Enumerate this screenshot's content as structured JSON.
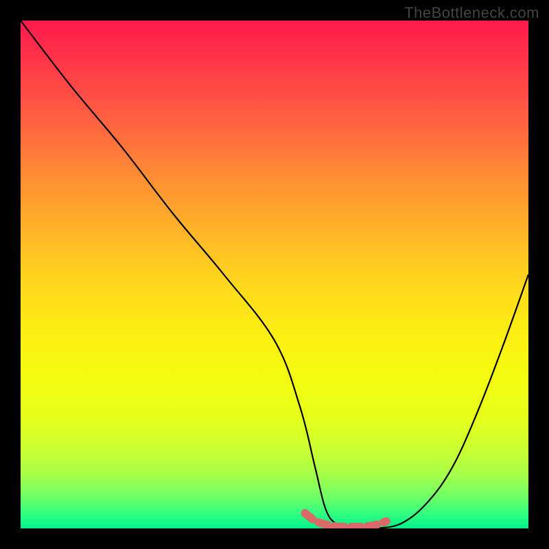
{
  "watermark": "TheBottleneck.com",
  "chart_data": {
    "type": "line",
    "title": "",
    "xlabel": "",
    "ylabel": "",
    "xlim": [
      0,
      100
    ],
    "ylim": [
      0,
      100
    ],
    "series": [
      {
        "name": "bottleneck-curve",
        "x": [
          0,
          10,
          20,
          30,
          40,
          50,
          55,
          58,
          60,
          62,
          65,
          68,
          70,
          75,
          80,
          85,
          90,
          95,
          100
        ],
        "values": [
          100,
          87,
          75,
          62,
          50,
          37,
          24,
          12,
          4,
          1,
          0,
          0,
          0,
          1,
          5,
          12,
          23,
          36,
          50
        ]
      },
      {
        "name": "bottom-highlight",
        "x": [
          56,
          58,
          60,
          62,
          64,
          66,
          68,
          70,
          72
        ],
        "values": [
          3,
          1.5,
          0.8,
          0.4,
          0.3,
          0.3,
          0.4,
          0.7,
          1.4
        ]
      }
    ],
    "colors": {
      "curve": "#000000",
      "highlight": "#d96a6a",
      "gradient_top": "#ff1a4d",
      "gradient_mid": "#ffd400",
      "gradient_bottom": "#00f28a"
    }
  }
}
